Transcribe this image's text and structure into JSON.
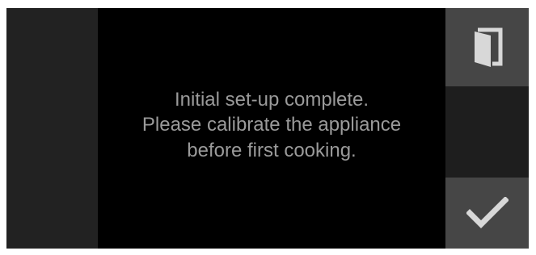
{
  "message": {
    "line1": "Initial set-up complete.",
    "line2": "Please calibrate the appliance",
    "line3": "before first cooking."
  },
  "buttons": {
    "door": {
      "icon": "door-icon"
    },
    "confirm": {
      "icon": "checkmark-icon"
    }
  },
  "colors": {
    "background": "#000000",
    "side_panel": "#222222",
    "button": "#464646",
    "text": "#9a9a9a",
    "icon": "#d8d8d8"
  }
}
